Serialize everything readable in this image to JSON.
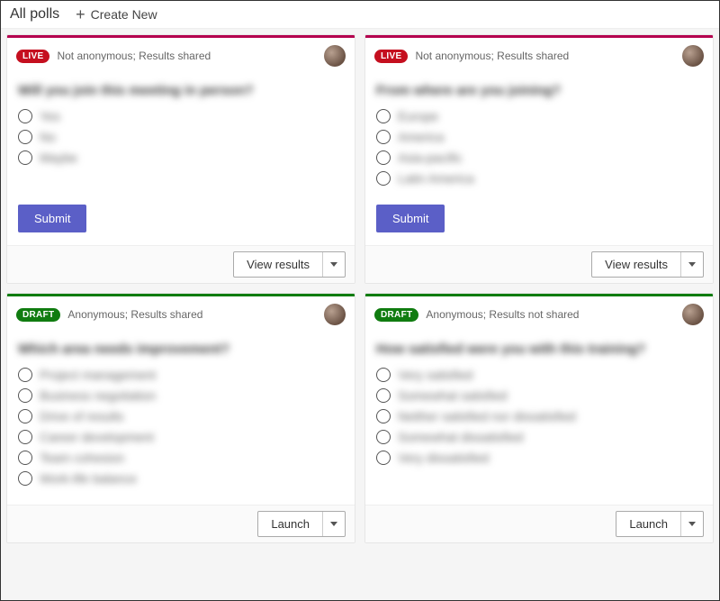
{
  "header": {
    "title": "All polls",
    "create_label": "Create New"
  },
  "cards": [
    {
      "status": "LIVE",
      "meta": "Not anonymous; Results shared",
      "question": "Will you join this meeting in person?",
      "options": [
        "Yes",
        "No",
        "Maybe"
      ],
      "submit_label": "Submit",
      "footer_action": "View results"
    },
    {
      "status": "LIVE",
      "meta": "Not anonymous; Results shared",
      "question": "From where are you joining?",
      "options": [
        "Europe",
        "America",
        "Asia-pacific",
        "Latin America"
      ],
      "submit_label": "Submit",
      "footer_action": "View results"
    },
    {
      "status": "DRAFT",
      "meta": "Anonymous; Results shared",
      "question": "Which area needs improvement?",
      "options": [
        "Project management",
        "Business negotiation",
        "Drive of results",
        "Career development",
        "Team cohesion",
        "Work-life balance"
      ],
      "footer_action": "Launch"
    },
    {
      "status": "DRAFT",
      "meta": "Anonymous; Results not shared",
      "question": "How satisfied were you with this training?",
      "options": [
        "Very satisfied",
        "Somewhat satisfied",
        "Neither satisfied nor dissatisfied",
        "Somewhat dissatisfied",
        "Very dissatisfied"
      ],
      "footer_action": "Launch"
    }
  ]
}
